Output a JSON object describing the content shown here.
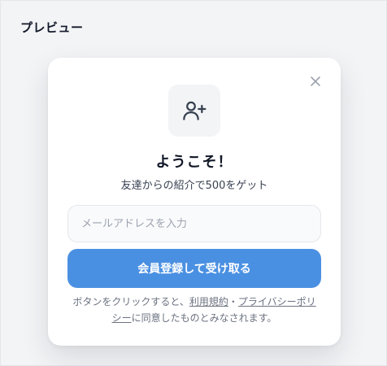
{
  "page": {
    "title": "プレビュー"
  },
  "modal": {
    "close_icon": "x-icon",
    "badge_icon": "user-plus-icon",
    "headline": "ようこそ！",
    "subtext": "友達からの紹介で500をゲット",
    "email_field": {
      "value": "",
      "placeholder": "メールアドレスを入力"
    },
    "submit_label": "会員登録して受け取る",
    "terms": {
      "prefix": "ボタンをクリックすると、",
      "terms_link": "利用規約",
      "separator": "・",
      "privacy_link": "プライバシーポリシー",
      "suffix": "に同意したものとみなされます。"
    }
  },
  "colors": {
    "primary": "#4a90e2",
    "background": "#f3f4f6",
    "card": "#ffffff",
    "text_dark": "#111827",
    "text_muted": "#6b7280"
  }
}
